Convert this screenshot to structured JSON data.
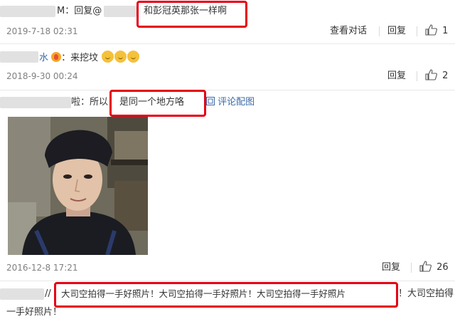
{
  "comments": [
    {
      "text_prefix": "M：回复@",
      "highlight": "和彭冠英那张一样啊",
      "date": "2019-7-18 02:31",
      "view_chat": "查看对话",
      "reply": "回复",
      "likes": "1"
    },
    {
      "text_prefix": "水",
      "text_main": "：来挖坟",
      "date": "2018-9-30 00:24",
      "reply": "回复",
      "likes": "2"
    },
    {
      "text_prefix": "啦：所以",
      "highlight": "是同一个地方咯",
      "pic_link": "评论配图",
      "date": "2016-12-8 17:21",
      "reply": "回复",
      "likes": "26"
    },
    {
      "text_prefix": "//",
      "highlight": "大司空拍得一手好照片！大司空拍得一手好照片！大司空拍得一手好照片",
      "text_tail": "！大司空拍得",
      "text_line2": "一手好照片！"
    }
  ],
  "icons": [
    "thumbs-up-icon",
    "image-icon",
    "doge-emoji-icon",
    "flame-badge-icon"
  ],
  "colors": {
    "highlight_border": "#e60012",
    "link": "#3b6aa5",
    "date": "#808080"
  }
}
